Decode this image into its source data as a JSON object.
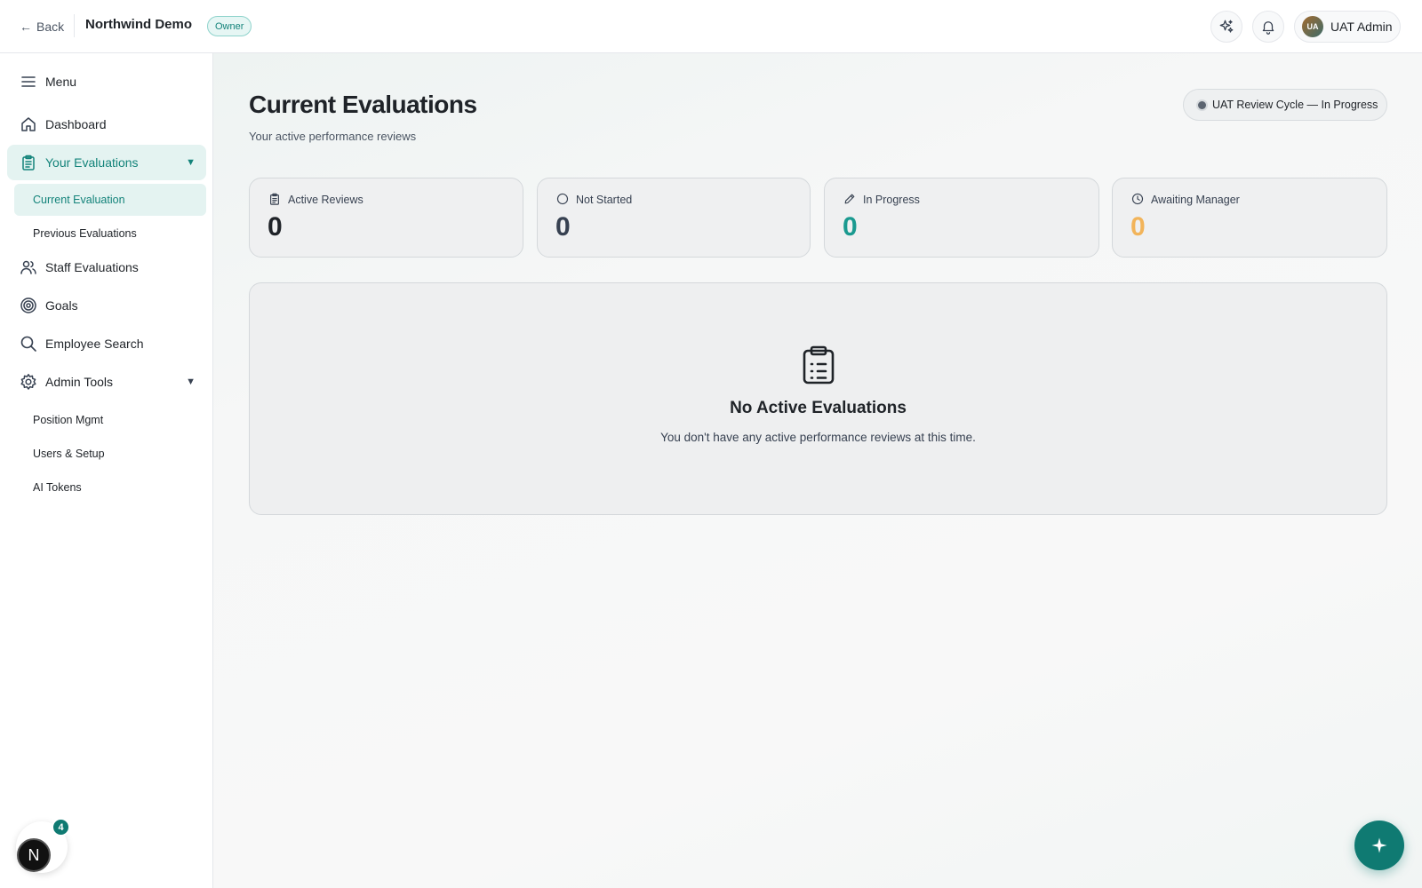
{
  "header": {
    "back_label": "Back",
    "back_arrow": "←",
    "org_name": "Northwind Demo",
    "role_badge": "Owner",
    "user_initials": "UA",
    "user_name": "UAT Admin",
    "icons": [
      "ai-sparkle-icon",
      "bell-icon"
    ]
  },
  "sidebar": {
    "menu_label": "Menu",
    "items": [
      {
        "label": "Dashboard",
        "icon": "home-icon"
      },
      {
        "label": "Your Evaluations",
        "icon": "clipboard-icon",
        "expanded": true,
        "active": true
      },
      {
        "label": "Staff Evaluations",
        "icon": "users-icon"
      },
      {
        "label": "Goals",
        "icon": "target-icon"
      },
      {
        "label": "Employee Search",
        "icon": "search-icon"
      },
      {
        "label": "Admin Tools",
        "icon": "gear-icon",
        "expanded": true
      }
    ],
    "evaluations_sub": [
      "Current Evaluation",
      "Previous Evaluations"
    ],
    "admin_sub": [
      "Position Mgmt",
      "Users & Setup",
      "AI Tokens"
    ],
    "caret": "▼",
    "bottom_avatar_letter": "N",
    "notification_count": "4"
  },
  "main": {
    "title": "Current Evaluations",
    "subtitle": "Your active performance reviews",
    "cycle_status": "UAT Review Cycle — In Progress",
    "stats": [
      {
        "label": "Active Reviews",
        "value": "0",
        "icon": "clipboard-icon",
        "color": "#1f2328"
      },
      {
        "label": "Not Started",
        "value": "0",
        "icon": "circle-icon",
        "color": "#374151"
      },
      {
        "label": "In Progress",
        "value": "0",
        "icon": "pencil-icon",
        "color": "#1a9a90"
      },
      {
        "label": "Awaiting Manager",
        "value": "0",
        "icon": "clock-icon",
        "color": "#f2b45a"
      }
    ],
    "empty_title": "No Active Evaluations",
    "empty_text": "You don't have any active performance reviews at this time."
  },
  "colors": {
    "accent": "#0f7a72",
    "accent_light": "#e4f3f1",
    "warning": "#f2b45a"
  }
}
